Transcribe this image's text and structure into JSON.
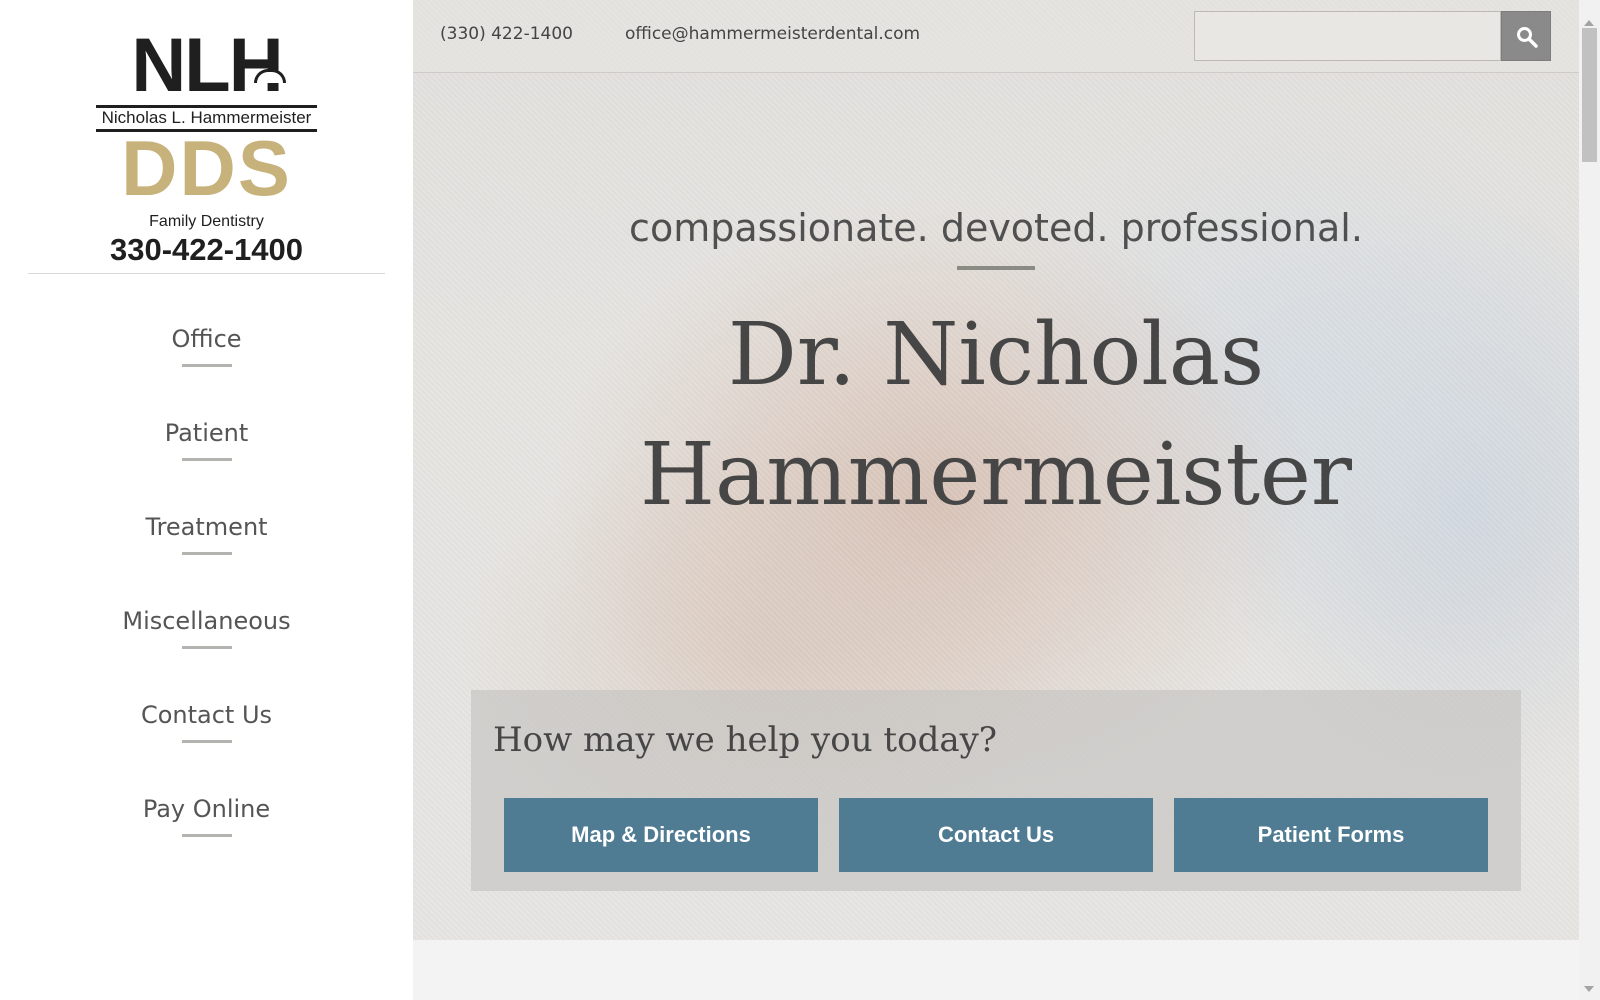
{
  "logo": {
    "initials": "NLH",
    "name": "Nicholas L. Hammermeister",
    "degree": "DDS",
    "practice": "Family Dentistry",
    "phone": "330-422-1400"
  },
  "nav": {
    "items": [
      {
        "label": "Office"
      },
      {
        "label": "Patient"
      },
      {
        "label": "Treatment"
      },
      {
        "label": "Miscellaneous"
      },
      {
        "label": "Contact Us"
      },
      {
        "label": "Pay Online"
      }
    ]
  },
  "topbar": {
    "phone": "(330) 422-1400",
    "email": "office@hammermeisterdental.com",
    "search_placeholder": "",
    "search_icon": "search-icon"
  },
  "hero": {
    "tagline": "compassionate. devoted. professional.",
    "title_line1": "Dr. Nicholas",
    "title_line2": "Hammermeister"
  },
  "help": {
    "title": "How may we help you today?",
    "buttons": [
      {
        "label": "Map & Directions"
      },
      {
        "label": "Contact Us"
      },
      {
        "label": "Patient Forms"
      }
    ]
  },
  "colors": {
    "accent_button": "#4f7b93",
    "logo_gold": "#c7b27b",
    "logo_dark": "#1f1f1f"
  }
}
